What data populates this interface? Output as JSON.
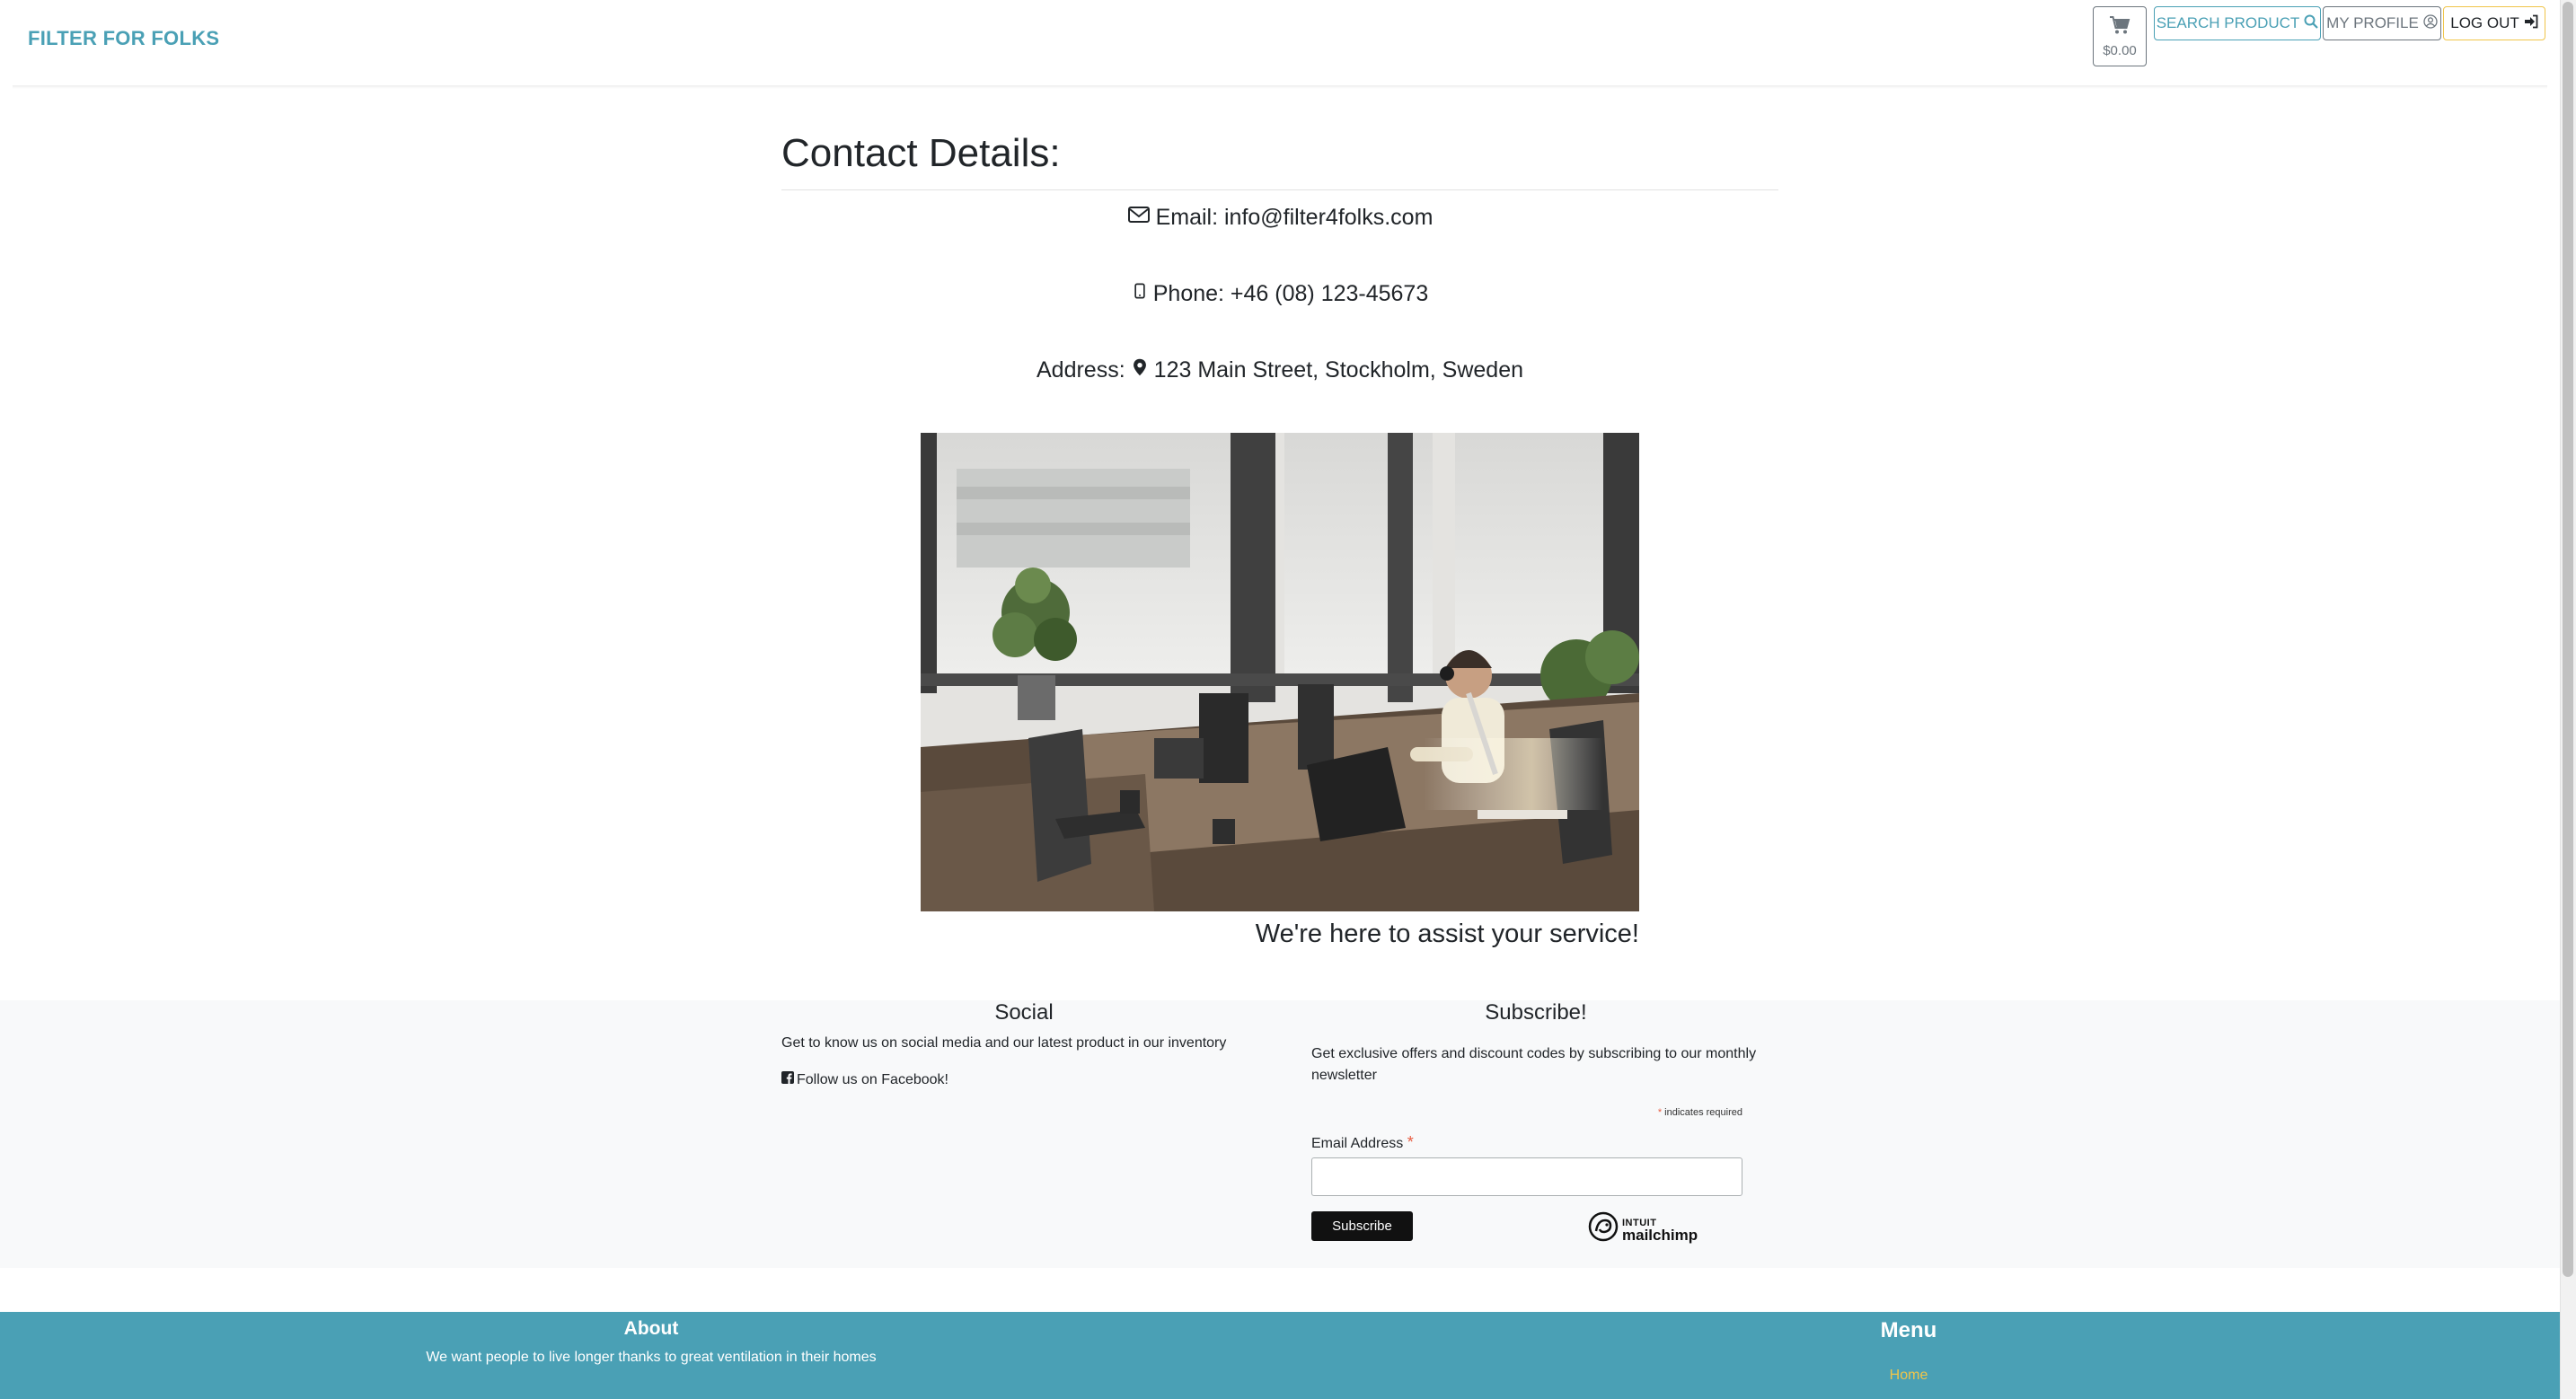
{
  "header": {
    "brand": "FILTER FOR FOLKS",
    "cart_total": "$0.00",
    "search_label": "SEARCH PRODUCT",
    "profile_label": "MY PROFILE",
    "logout_label": "LOG OUT"
  },
  "contact": {
    "title": "Contact Details:",
    "email": "Email: info@filter4folks.com",
    "phone": "Phone: +46 (08) 123-45673",
    "address_label": "Address:",
    "address_value": "123 Main Street, Stockholm, Sweden",
    "caption": "We're here to assist your service!"
  },
  "social": {
    "title": "Social",
    "text": "Get to know us on social media and our latest product in our inventory",
    "facebook_link": "Follow us on Facebook!"
  },
  "subscribe": {
    "title": "Subscribe!",
    "text": "Get exclusive offers and discount codes by subscribing to our monthly newsletter",
    "required_note": "indicates required",
    "required_star": "*",
    "email_label": "Email Address",
    "email_value": "",
    "button_label": "Subscribe",
    "badge_small": "INTUIT",
    "badge_big": "mailchimp"
  },
  "footer": {
    "about_title": "About",
    "about_text": "We want people to live longer thanks to great ventilation in their homes",
    "menu_title": "Menu",
    "menu_home": "Home"
  },
  "icons": {
    "cart": "cart-icon",
    "search": "search-icon",
    "profile": "user-circle-icon",
    "logout": "sign-in-icon",
    "email": "envelope-icon",
    "phone": "mobile-phone-icon",
    "address": "map-marker-icon",
    "facebook": "facebook-square-icon",
    "mailchimp": "mailchimp-logo-icon"
  },
  "colors": {
    "brand": "#4aa0b5",
    "accent_yellow": "#f0c54a",
    "footer_bg": "#4aa0b5",
    "light_section_bg": "#f8f9fa",
    "subscribe_button": "#111111"
  }
}
